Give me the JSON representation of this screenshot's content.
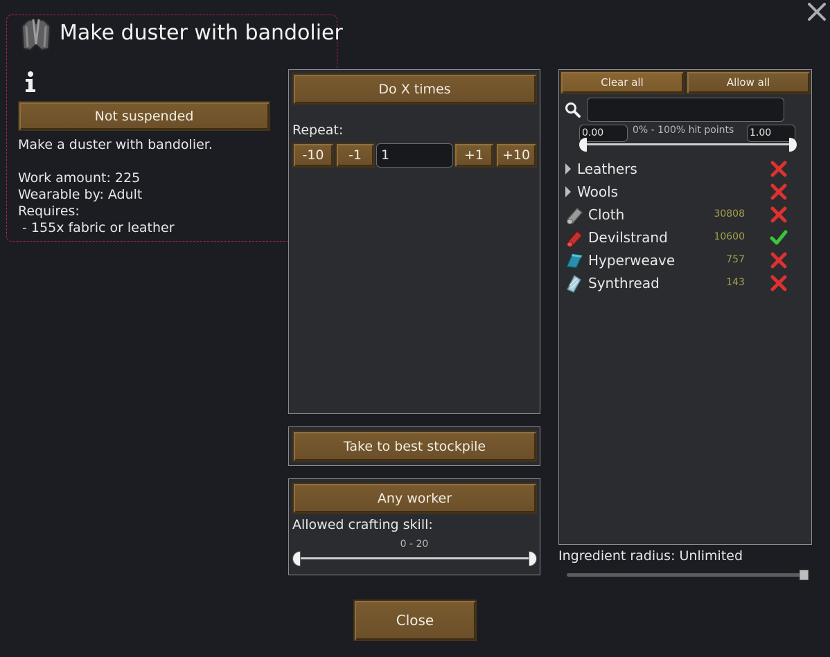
{
  "window": {
    "title": "Make duster with bandolier",
    "status_button": "Not suspended",
    "description": "Make a duster with bandolier.",
    "work_amount": "Work amount: 225",
    "wearable_by": "Wearable by: Adult",
    "requires_label": "Requires:",
    "requires_item": " - 155x fabric or leather",
    "close_label": "Close"
  },
  "bill": {
    "mode_button": "Do X times",
    "repeat_label": "Repeat:",
    "dec10": "-10",
    "dec1": "-1",
    "repeat_value": "1",
    "inc1": "+1",
    "inc10": "+10",
    "store_button": "Take to best stockpile",
    "worker_button": "Any worker",
    "skill_label": "Allowed crafting skill:",
    "skill_range": "0 - 20"
  },
  "filter": {
    "clear_all": "Clear all",
    "allow_all": "Allow all",
    "search_value": "",
    "hp_min": "0.00",
    "hp_max": "1.00",
    "hp_label": "0% - 100% hit points",
    "categories": [
      {
        "label": "Leathers",
        "allowed": false
      },
      {
        "label": "Wools",
        "allowed": false
      }
    ],
    "items": [
      {
        "label": "Cloth",
        "count": "30808",
        "allowed": false,
        "icon": "cloth-icon",
        "color": "#9a9a98"
      },
      {
        "label": "Devilstrand",
        "count": "10600",
        "allowed": true,
        "icon": "devilstrand-icon",
        "color": "#c23232"
      },
      {
        "label": "Hyperweave",
        "count": "757",
        "allowed": false,
        "icon": "hyperweave-icon",
        "color": "#2a8fa8"
      },
      {
        "label": "Synthread",
        "count": "143",
        "allowed": false,
        "icon": "synthread-icon",
        "color": "#a8d0dc"
      }
    ],
    "ingredient_radius": "Ingredient radius: Unlimited"
  },
  "colors": {
    "button": "#6b4f29",
    "cross": "#e03030",
    "check": "#3cc43c",
    "count": "#a5a04a"
  }
}
